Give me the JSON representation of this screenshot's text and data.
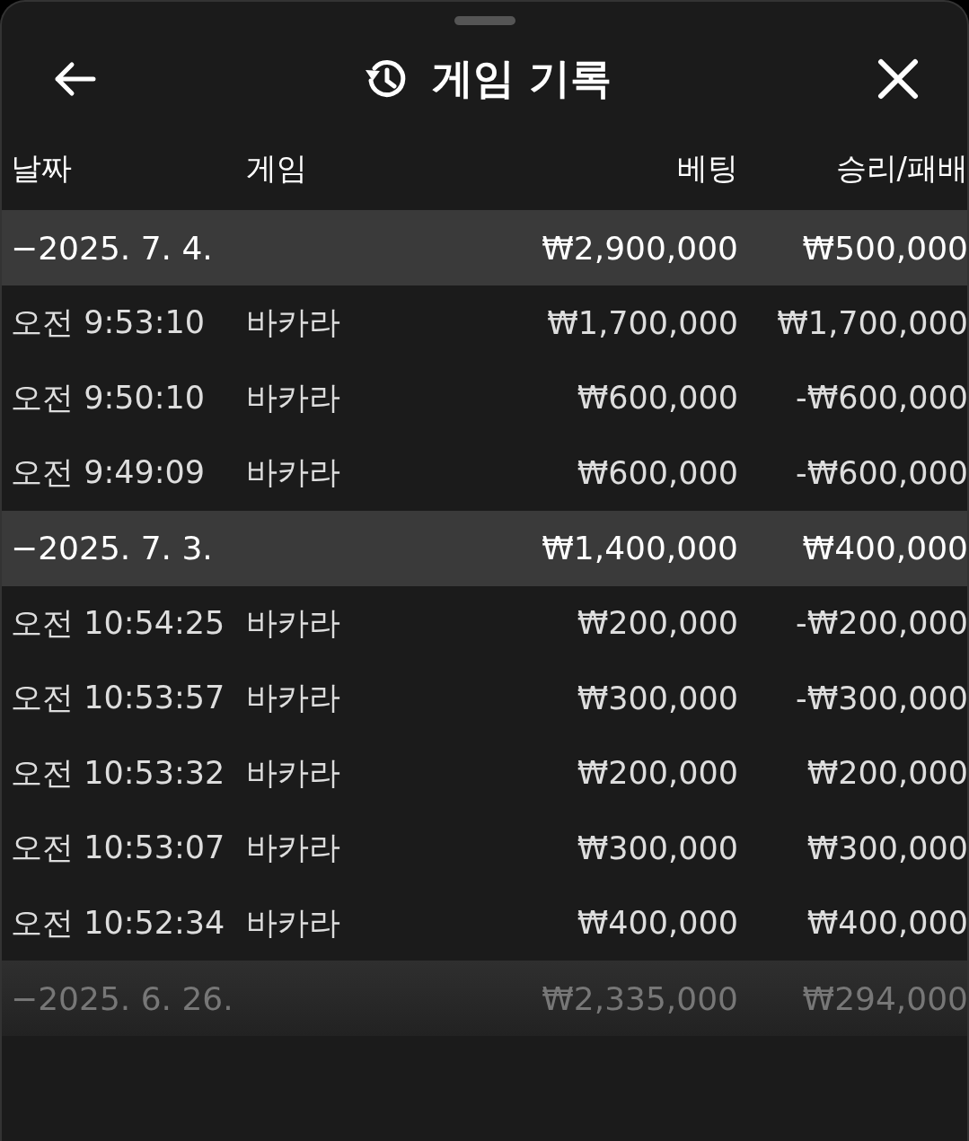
{
  "header": {
    "title": "게임 기록"
  },
  "columns": [
    "날짜",
    "게임",
    "베팅",
    "승리/패배"
  ],
  "groups": [
    {
      "date": "−2025. 7. 4.",
      "bet": "₩2,900,000",
      "result": "₩500,000",
      "faded": false,
      "items": [
        {
          "time": "오전 9:53:10",
          "game": "바카라",
          "bet": "₩1,700,000",
          "result": "₩1,700,000"
        },
        {
          "time": "오전 9:50:10",
          "game": "바카라",
          "bet": "₩600,000",
          "result": "-₩600,000"
        },
        {
          "time": "오전 9:49:09",
          "game": "바카라",
          "bet": "₩600,000",
          "result": "-₩600,000"
        }
      ]
    },
    {
      "date": "−2025. 7. 3.",
      "bet": "₩1,400,000",
      "result": "₩400,000",
      "faded": false,
      "items": [
        {
          "time": "오전 10:54:25",
          "game": "바카라",
          "bet": "₩200,000",
          "result": "-₩200,000"
        },
        {
          "time": "오전 10:53:57",
          "game": "바카라",
          "bet": "₩300,000",
          "result": "-₩300,000"
        },
        {
          "time": "오전 10:53:32",
          "game": "바카라",
          "bet": "₩200,000",
          "result": "₩200,000"
        },
        {
          "time": "오전 10:53:07",
          "game": "바카라",
          "bet": "₩300,000",
          "result": "₩300,000"
        },
        {
          "time": "오전 10:52:34",
          "game": "바카라",
          "bet": "₩400,000",
          "result": "₩400,000"
        }
      ]
    },
    {
      "date": "−2025. 6. 26.",
      "bet": "₩2,335,000",
      "result": "₩294,000",
      "faded": true
    }
  ]
}
